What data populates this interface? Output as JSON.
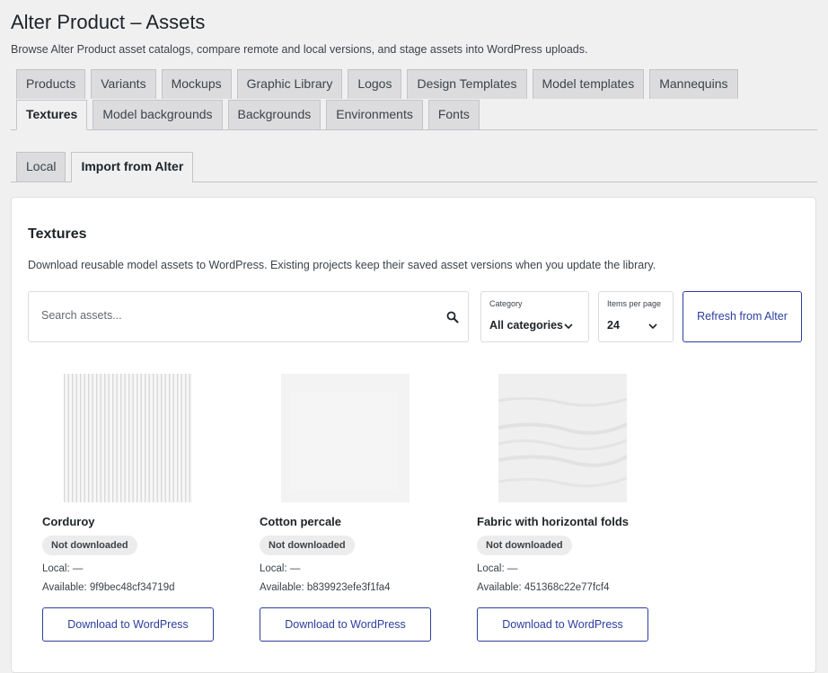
{
  "page": {
    "title": "Alter Product – Assets",
    "description": "Browse Alter Product asset catalogs, compare remote and local versions, and stage assets into WordPress uploads."
  },
  "tabs_row1": [
    "Products",
    "Variants",
    "Mockups",
    "Graphic Library",
    "Logos",
    "Design Templates",
    "Model templates",
    "Mannequins"
  ],
  "tabs_row2": [
    "Textures",
    "Model backgrounds",
    "Backgrounds",
    "Environments",
    "Fonts"
  ],
  "active_tab": "Textures",
  "sub_tabs": [
    "Local",
    "Import from Alter"
  ],
  "active_sub_tab": "Import from Alter",
  "section": {
    "title": "Textures",
    "description": "Download reusable model assets to WordPress. Existing projects keep their saved asset versions when you update the library."
  },
  "search": {
    "placeholder": "Search assets...",
    "value": ""
  },
  "category": {
    "label": "Category",
    "value": "All categories"
  },
  "per_page": {
    "label": "Items per page",
    "value": "24"
  },
  "refresh_label": "Refresh from Alter",
  "icons": {
    "search": "search-icon",
    "chevron": "chevron-down-icon"
  },
  "colors": {
    "accent": "#2c3e9e",
    "badge_bg": "#ececec",
    "background": "#f0f0f1"
  },
  "assets": [
    {
      "name": "Corduroy",
      "status": "Not downloaded",
      "local": "Local: —",
      "available": "Available: 9f9bec48cf34719d",
      "button": "Download to WordPress"
    },
    {
      "name": "Cotton percale",
      "status": "Not downloaded",
      "local": "Local: —",
      "available": "Available: b839923efe3f1fa4",
      "button": "Download to WordPress"
    },
    {
      "name": "Fabric with horizontal folds",
      "status": "Not downloaded",
      "local": "Local: —",
      "available": "Available: 451368c22e77fcf4",
      "button": "Download to WordPress"
    }
  ]
}
